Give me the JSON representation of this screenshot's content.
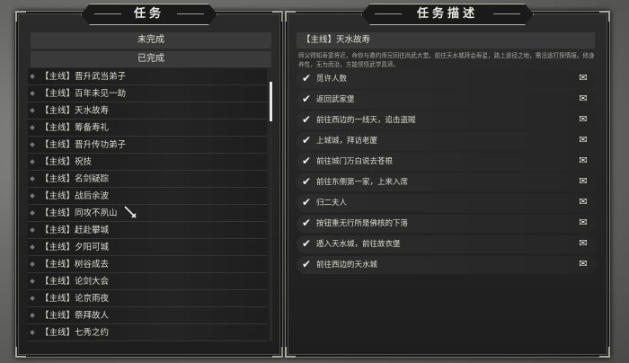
{
  "left": {
    "title": "任务",
    "tabs": {
      "incomplete": "未完成",
      "complete": "已完成"
    },
    "quests": [
      "【主线】晋升武当弟子",
      "【主线】百年未见一劫",
      "【主线】天水故寿",
      "【主线】筹备寿礼",
      "【主线】晋升传功弟子",
      "【主线】祝技",
      "【主线】名剑疑踪",
      "【主线】战后余波",
      "【主线】同攻不夙山",
      "【主线】赶赴攀城",
      "【主线】夕阳可城",
      "【主线】树谷成去",
      "【主线】论剑大会",
      "【主线】论京雨夜",
      "【主线】祭拜故人",
      "【主线】七秀之约"
    ],
    "scroll_fraction": 0.05
  },
  "right": {
    "title": "任务描述",
    "quest_title": "【主线】天水故寿",
    "description": "师父得知寿宴将近，命你与邀约师兄同往尚武大堂。前往天水城拜会寿星，路上途径之地，需沿途打探情报。修身养性，无为而治，方能领悟武学真谛。",
    "objectives": [
      "觅许人数",
      "返回武家堡",
      "前往西边的一线天，追击盗贼",
      "上城城，拜访老厦",
      "前往城门万白说去苍根",
      "前往东侧第一家，上来入席",
      "归二夫人",
      "按钮重无行所是佛核的下落",
      "遁入天水城，前往故衣堡",
      "前往西边的天水城"
    ]
  }
}
